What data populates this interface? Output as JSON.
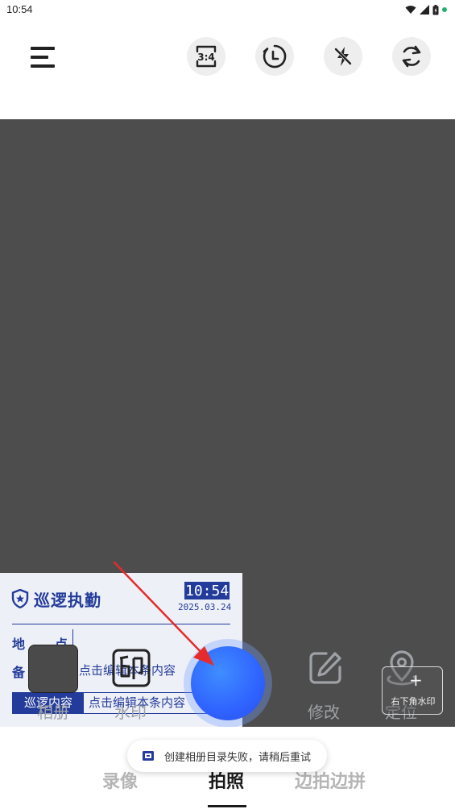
{
  "status_bar": {
    "time": "10:54"
  },
  "toolbar": {
    "ratio_label": "3:4"
  },
  "watermark": {
    "title": "巡逻执勤",
    "time": "10:54",
    "date": "2025.03.24",
    "location_label_a": "地",
    "location_label_b": "点",
    "remark_label": "备",
    "remark_value": "点击编辑本条内容",
    "patrol_label": "巡逻内容",
    "patrol_value": "点击编辑本条内容"
  },
  "controls": {
    "album_label": "相册",
    "watermark_label": "水印",
    "edit_label": "修改",
    "location_label": "定位",
    "corner_plus": "+",
    "corner_label": "右下角水印"
  },
  "modes": [
    {
      "label": "录像",
      "active": false
    },
    {
      "label": "拍照",
      "active": true
    },
    {
      "label": "边拍边拼",
      "active": false
    }
  ],
  "toast": {
    "message": "创建相册目录失败，请稍后重试"
  },
  "colors": {
    "accent": "#233b9a",
    "shutter": "#2f63ff",
    "viewfinder": "#4d4d4d"
  }
}
